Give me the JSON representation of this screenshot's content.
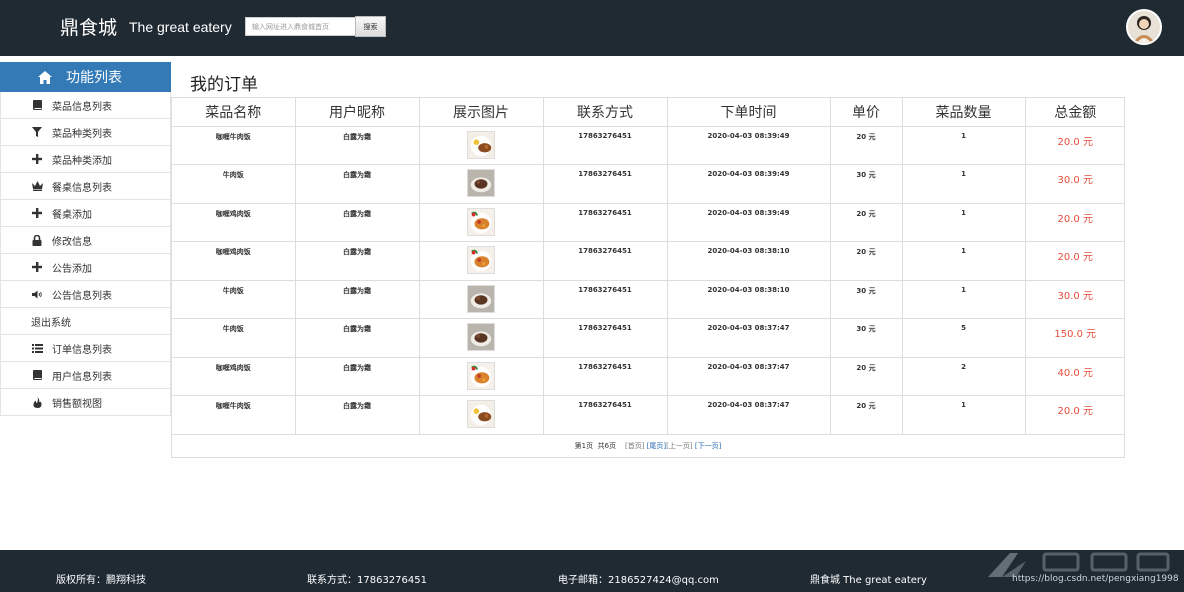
{
  "header": {
    "brand_cn": "鼎食城",
    "brand_en": "The great eatery",
    "search_placeholder": "输入网址进入鼎食城首页",
    "search_button": "搜索"
  },
  "sidebar": {
    "title": "功能列表",
    "items": [
      {
        "label": "菜品信息列表",
        "icon": "book-icon"
      },
      {
        "label": "菜品种类列表",
        "icon": "filter-icon"
      },
      {
        "label": "菜品种类添加",
        "icon": "plus-icon"
      },
      {
        "label": "餐桌信息列表",
        "icon": "crown-icon"
      },
      {
        "label": "餐桌添加",
        "icon": "plus-icon"
      },
      {
        "label": "修改信息",
        "icon": "lock-icon"
      },
      {
        "label": "公告添加",
        "icon": "plus-icon"
      },
      {
        "label": "公告信息列表",
        "icon": "volume-icon"
      },
      {
        "label": "退出系统",
        "icon": ""
      },
      {
        "label": "订单信息列表",
        "icon": "list-icon"
      },
      {
        "label": "用户信息列表",
        "icon": "book-icon"
      },
      {
        "label": "销售额视图",
        "icon": "fire-icon"
      }
    ]
  },
  "main": {
    "title": "我的订单",
    "columns": [
      "菜品名称",
      "用户昵称",
      "展示图片",
      "联系方式",
      "下单时间",
      "单价",
      "菜品数量",
      "总金额"
    ],
    "rows": [
      {
        "dish": "咖喱牛肉饭",
        "user": "白露为霜",
        "image": "curry-beef",
        "phone": "17863276451",
        "time": "2020-04-03 08:39:49",
        "price": "20 元",
        "qty": "1",
        "total": "20.0 元"
      },
      {
        "dish": "牛肉饭",
        "user": "白露为霜",
        "image": "beef",
        "phone": "17863276451",
        "time": "2020-04-03 08:39:49",
        "price": "30 元",
        "qty": "1",
        "total": "30.0 元"
      },
      {
        "dish": "咖喱鸡肉饭",
        "user": "白露为霜",
        "image": "curry-chicken",
        "phone": "17863276451",
        "time": "2020-04-03 08:39:49",
        "price": "20 元",
        "qty": "1",
        "total": "20.0 元"
      },
      {
        "dish": "咖喱鸡肉饭",
        "user": "白露为霜",
        "image": "curry-chicken",
        "phone": "17863276451",
        "time": "2020-04-03 08:38:10",
        "price": "20 元",
        "qty": "1",
        "total": "20.0 元"
      },
      {
        "dish": "牛肉饭",
        "user": "白露为霜",
        "image": "beef",
        "phone": "17863276451",
        "time": "2020-04-03 08:38:10",
        "price": "30 元",
        "qty": "1",
        "total": "30.0 元"
      },
      {
        "dish": "牛肉饭",
        "user": "白露为霜",
        "image": "beef",
        "phone": "17863276451",
        "time": "2020-04-03 08:37:47",
        "price": "30 元",
        "qty": "5",
        "total": "150.0 元"
      },
      {
        "dish": "咖喱鸡肉饭",
        "user": "白露为霜",
        "image": "curry-chicken",
        "phone": "17863276451",
        "time": "2020-04-03 08:37:47",
        "price": "20 元",
        "qty": "2",
        "total": "40.0 元"
      },
      {
        "dish": "咖喱牛肉饭",
        "user": "白露为霜",
        "image": "curry-beef",
        "phone": "17863276451",
        "time": "2020-04-03 08:37:47",
        "price": "20 元",
        "qty": "1",
        "total": "20.0 元"
      }
    ],
    "pager": {
      "current": "第1页",
      "total": "共6页",
      "first": "[首页]",
      "last": "[尾页]",
      "prev": "[上一页]",
      "next": "[下一页]"
    }
  },
  "footer": {
    "copyright": "版权所有：鹏翔科技",
    "contact": "联系方式：17863276451",
    "email": "电子邮箱：2186527424@qq.com",
    "brand": "鼎食城 The great eatery"
  },
  "watermark": {
    "url": "https://blog.csdn.net/pengxiang1998"
  },
  "colors": {
    "header_bg": "#1f2a33",
    "sidebar_head": "#337ab7",
    "total_red": "#e74c3c",
    "link_blue": "#2a6ab3"
  }
}
